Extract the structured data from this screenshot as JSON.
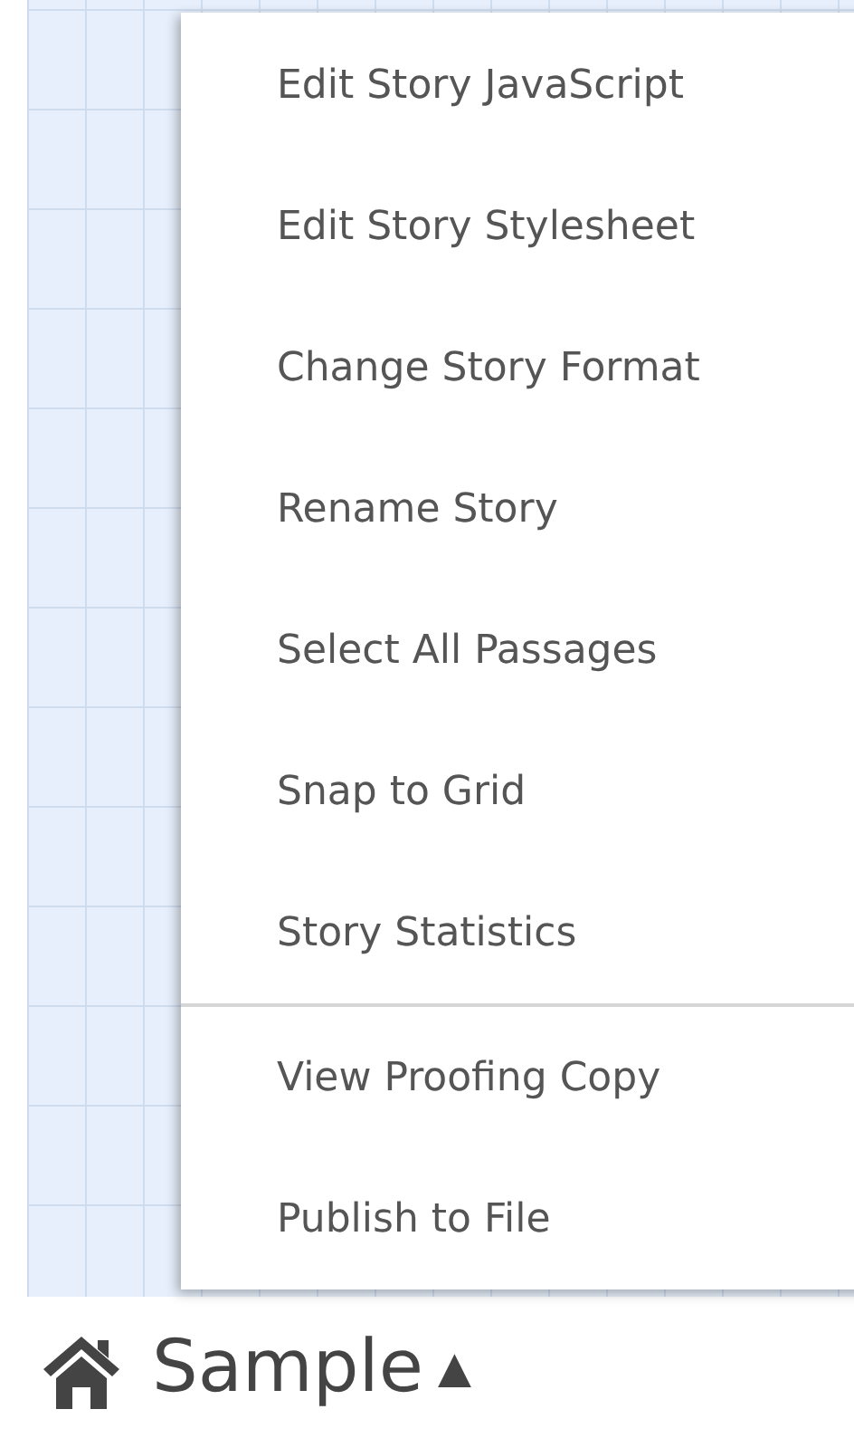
{
  "story_menu": {
    "sections": [
      {
        "items": [
          {
            "label": "Edit Story JavaScript"
          },
          {
            "label": "Edit Story Stylesheet"
          },
          {
            "label": "Change Story Format"
          },
          {
            "label": "Rename Story"
          },
          {
            "label": "Select All Passages"
          },
          {
            "label": "Snap to Grid"
          },
          {
            "label": "Story Statistics"
          }
        ]
      },
      {
        "items": [
          {
            "label": "View Proofing Copy"
          },
          {
            "label": "Publish to File"
          }
        ]
      }
    ]
  },
  "story_bar": {
    "title": "Sample",
    "caret": "▲"
  }
}
